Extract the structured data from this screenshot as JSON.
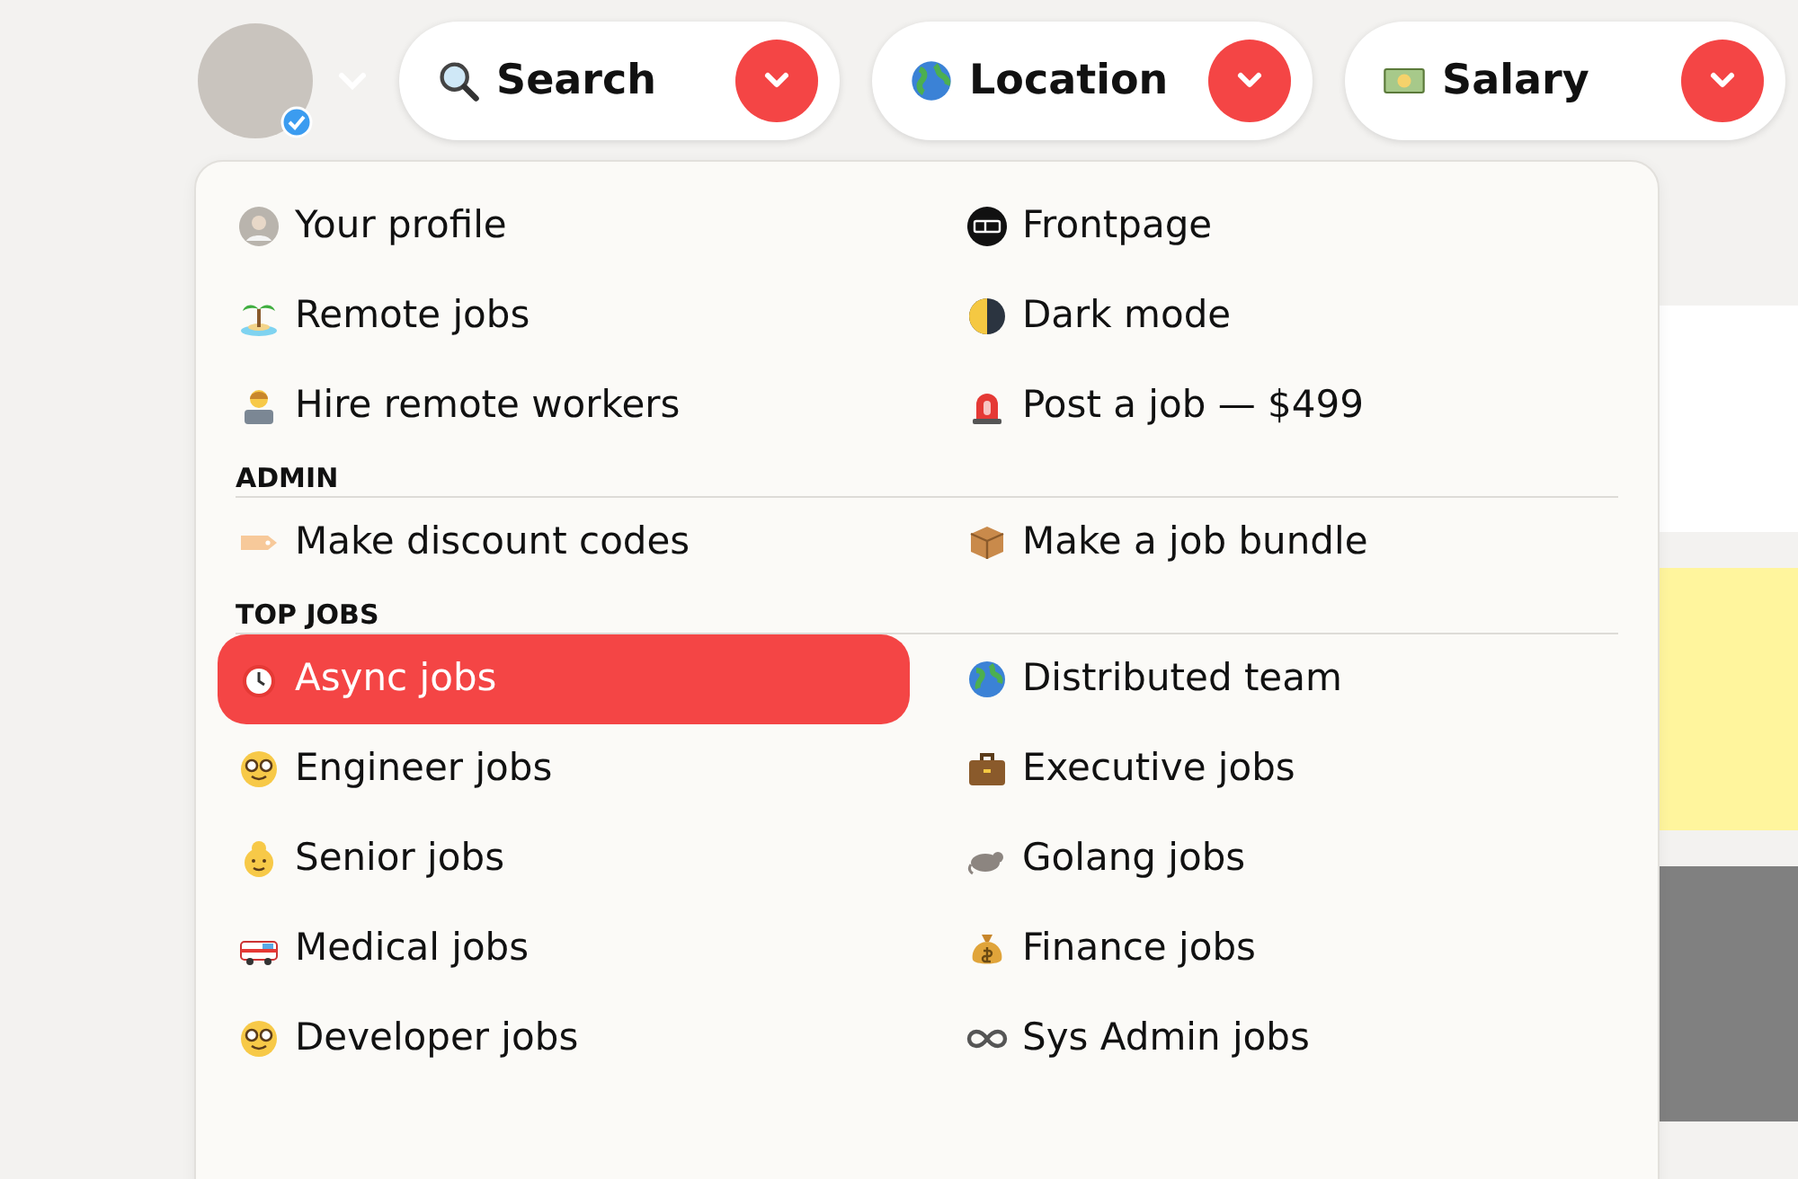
{
  "filters": [
    {
      "label": "Search"
    },
    {
      "label": "Location"
    },
    {
      "label": "Salary"
    }
  ],
  "menu": {
    "sections": [
      {
        "items": [
          {
            "label": "Your profile",
            "selected": false
          },
          {
            "label": "Frontpage",
            "selected": false
          },
          {
            "label": "Remote jobs",
            "selected": false
          },
          {
            "label": "Dark mode",
            "selected": false
          },
          {
            "label": "Hire remote workers",
            "selected": false
          },
          {
            "label": "Post a job — $499",
            "selected": false
          }
        ]
      },
      {
        "heading": "ADMIN",
        "items": [
          {
            "label": "Make discount codes",
            "selected": false
          },
          {
            "label": "Make a job bundle",
            "selected": false
          }
        ]
      },
      {
        "heading": "TOP JOBS",
        "items": [
          {
            "label": "Async jobs",
            "selected": true
          },
          {
            "label": "Distributed team",
            "selected": false
          },
          {
            "label": "Engineer jobs",
            "selected": false
          },
          {
            "label": "Executive jobs",
            "selected": false
          },
          {
            "label": "Senior jobs",
            "selected": false
          },
          {
            "label": "Golang jobs",
            "selected": false
          },
          {
            "label": "Medical jobs",
            "selected": false
          },
          {
            "label": "Finance jobs",
            "selected": false
          },
          {
            "label": "Developer jobs",
            "selected": false
          },
          {
            "label": "Sys Admin jobs",
            "selected": false
          }
        ]
      }
    ]
  }
}
